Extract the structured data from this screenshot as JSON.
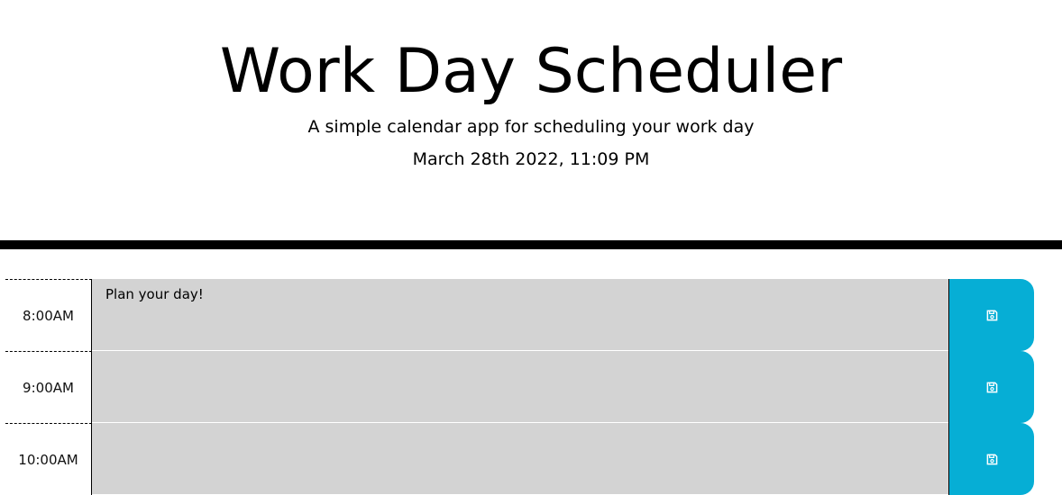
{
  "header": {
    "title": "Work Day Scheduler",
    "subtitle": "A simple calendar app for scheduling your work day",
    "current_day": "March 28th 2022, 11:09 PM"
  },
  "time_blocks": [
    {
      "hour": "8:00AM",
      "text": "",
      "placeholder": "Plan your day!",
      "save_icon": "floppy-disk-icon"
    },
    {
      "hour": "9:00AM",
      "text": "",
      "placeholder": "",
      "save_icon": "floppy-disk-icon"
    },
    {
      "hour": "10:00AM",
      "text": "",
      "placeholder": "",
      "save_icon": "floppy-disk-icon"
    }
  ],
  "colors": {
    "past": "#d3d3d3",
    "save_button": "#06aed5",
    "divider": "#000000"
  }
}
